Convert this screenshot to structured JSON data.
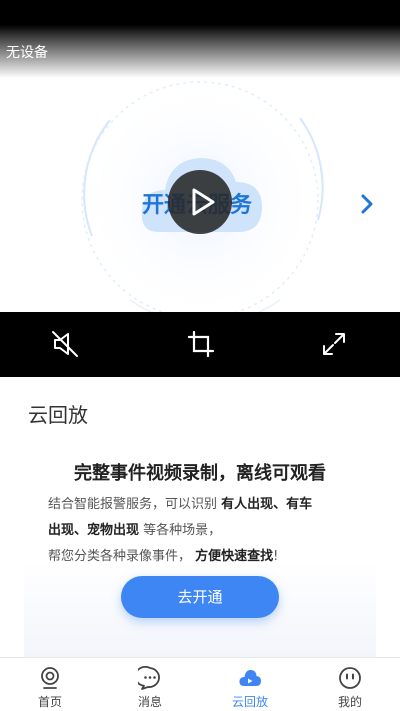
{
  "player": {
    "device_status": "无设备",
    "promo_text": "开通云服务"
  },
  "controls": {
    "mute_icon": "speaker-mute-icon",
    "crop_icon": "crop-icon",
    "fullscreen_icon": "expand-icon"
  },
  "panel": {
    "title": "云回放",
    "headline": "完整事件视频录制，离线可观看",
    "desc": {
      "line1_prefix": "结合智能报警服务，可以识别 ",
      "line1_bold": "有人出现、有车",
      "line2_bold": "出现、宠物出现",
      "line2_suffix": " 等各种场景，",
      "line3_prefix": "帮您分类各种录像事件， ",
      "line3_bold": "方便快速查找",
      "line3_suffix": "!"
    },
    "cta_label": "去开通"
  },
  "tabs": [
    {
      "label": "首页",
      "icon": "camera-icon"
    },
    {
      "label": "消息",
      "icon": "chat-icon"
    },
    {
      "label": "云回放",
      "icon": "cloud-icon"
    },
    {
      "label": "我的",
      "icon": "face-icon"
    }
  ],
  "colors": {
    "accent": "#3f86f5",
    "promo_blue": "#1f74d9",
    "control_bar": "#000000"
  }
}
